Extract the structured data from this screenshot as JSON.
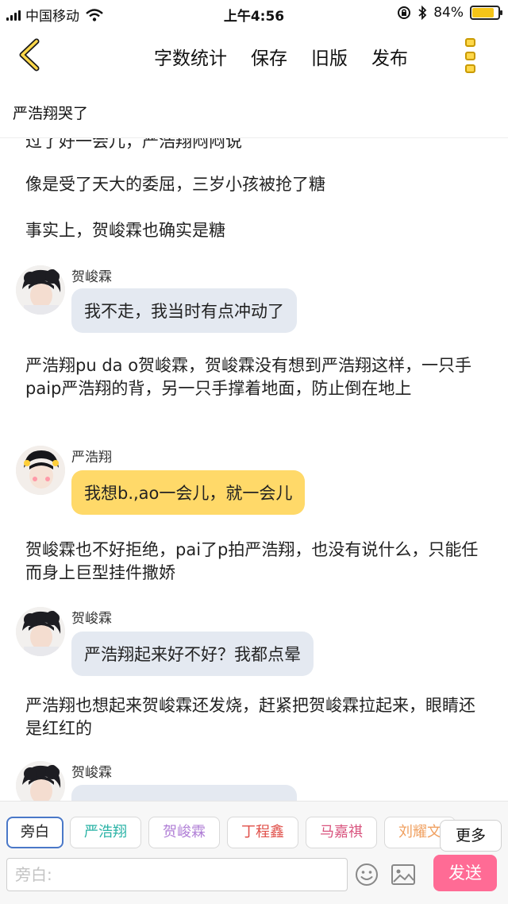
{
  "status_bar": {
    "carrier": "中国移动",
    "time": "上午4:56",
    "battery_percent": "84%",
    "battery_level": 0.84
  },
  "nav": {
    "word_count": "字数统计",
    "save": "保存",
    "old_version": "旧版",
    "publish": "发布"
  },
  "story_title": "严浩翔哭了",
  "content": {
    "cut_line": "过了好一会儿，严浩翔闷闷说",
    "para_1": "像是受了天大的委屈，三岁小孩被抢了糖",
    "para_2": "事实上，贺峻霖也确实是糖",
    "msg_1": {
      "speaker": "贺峻霖",
      "text": "我不走，我当时有点冲动了"
    },
    "para_3": "严浩翔pu da o贺峻霖，贺峻霖没有想到严浩翔这样，一只手paip严浩翔的背，另一只手撑着地面，防止倒在地上",
    "msg_2": {
      "speaker": "严浩翔",
      "text": "我想b.,ao一会儿，就一会儿"
    },
    "para_4": "贺峻霖也不好拒绝，pai了p拍严浩翔，也没有说什么，只能任而身上巨型挂件撒娇",
    "msg_3": {
      "speaker": "贺峻霖",
      "text": "严浩翔起来好不好？我都点晕"
    },
    "para_5": "严浩翔也想起来贺峻霖还发烧，赶紧把贺峻霖拉起来，眼睛还是红红的",
    "msg_4": {
      "speaker": "贺峻霖"
    }
  },
  "roles": {
    "narration": "旁白",
    "role_1": "严浩翔",
    "role_2": "贺峻霖",
    "role_3": "丁程鑫",
    "role_4": "马嘉祺",
    "role_5": "刘耀文",
    "more": "更多"
  },
  "input": {
    "placeholder": "旁白:",
    "send": "发送"
  },
  "colors": {
    "accent_yellow": "#ffd969",
    "bubble_grey": "#e4e9f1",
    "send_pink": "#ff6b95",
    "role_1": "#2ab3a6",
    "role_2": "#b07fd6",
    "role_3": "#e0504a",
    "role_4": "#d9557f",
    "role_5": "#f0a060"
  }
}
